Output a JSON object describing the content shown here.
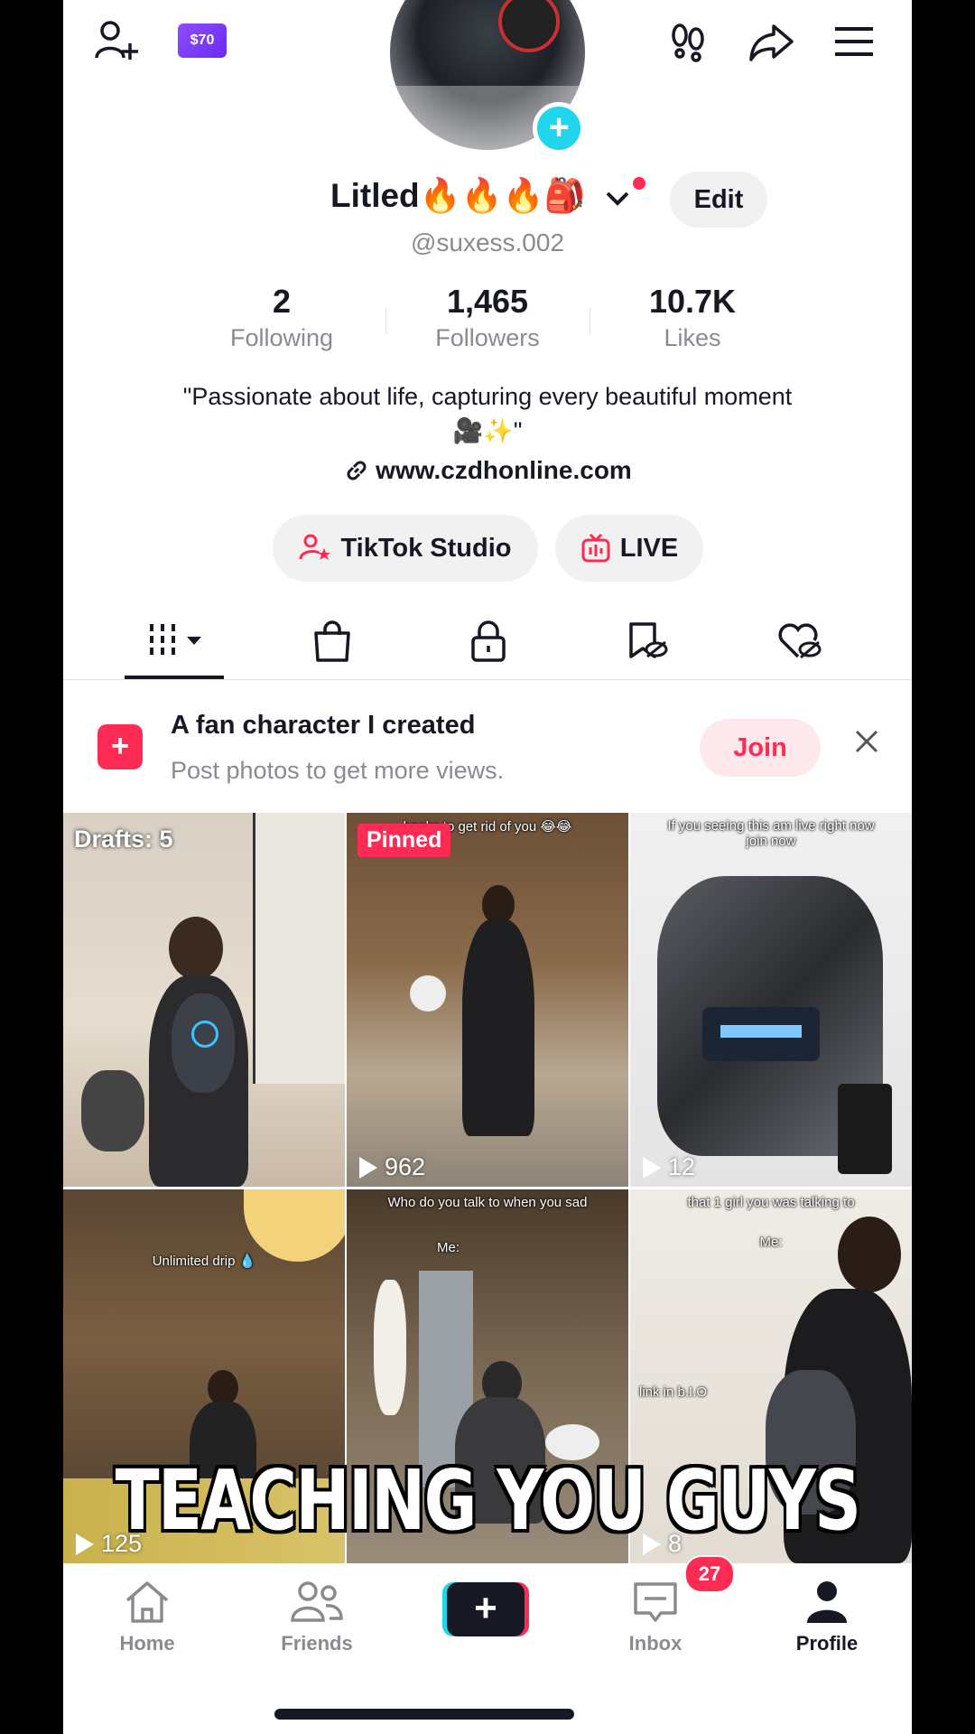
{
  "profile": {
    "display_name": "Litled🔥🔥🔥🎒",
    "username": "@suxess.002",
    "edit_label": "Edit",
    "coins_label": "$70",
    "bio": "\"Passionate about life, capturing every beautiful moment 🎥✨\"",
    "website": "www.czdhonline.com"
  },
  "stats": [
    {
      "value": "2",
      "label": "Following"
    },
    {
      "value": "1,465",
      "label": "Followers"
    },
    {
      "value": "10.7K",
      "label": "Likes"
    }
  ],
  "actions": {
    "studio_label": "TikTok Studio",
    "live_label": "LIVE"
  },
  "promo": {
    "title": "A fan character I created",
    "subtitle": "Post photos to get more views.",
    "join_label": "Join"
  },
  "videos": [
    {
      "badge": "Drafts: 5",
      "caption": "",
      "views": ""
    },
    {
      "badge": "Pinned",
      "caption": "books to get rid of you 😂😂",
      "views": "962"
    },
    {
      "badge": "",
      "caption": "If you seeing this am live right now join now",
      "views": "12"
    },
    {
      "badge": "",
      "caption": "Unlimited drip 💧",
      "views": "125"
    },
    {
      "badge": "",
      "caption": "Who do you talk to when you sad",
      "caption2": "Me:",
      "views": ""
    },
    {
      "badge": "",
      "caption": "that 1 girl you was talking to",
      "caption2": "Me:",
      "caption3": "link in b.I.O",
      "views": "8"
    }
  ],
  "overlay_caption": "TEACHING YOU GUYS",
  "nav": {
    "home": "Home",
    "friends": "Friends",
    "inbox": "Inbox",
    "inbox_count": "27",
    "profile": "Profile"
  },
  "colors": {
    "accent": "#fe2c55",
    "cyan": "#20d5ec",
    "text": "#161823",
    "muted": "#8a8b91"
  }
}
